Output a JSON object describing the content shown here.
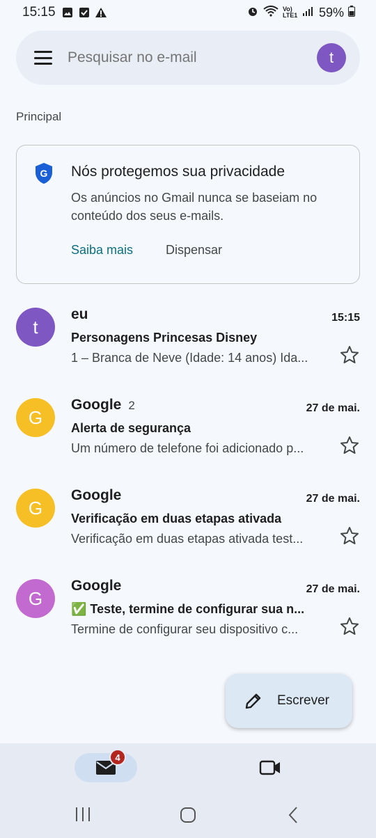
{
  "status_bar": {
    "time": "15:15",
    "network": "Vo) LTE1",
    "battery": "59%"
  },
  "search": {
    "placeholder": "Pesquisar no e-mail",
    "avatar_letter": "t"
  },
  "section_label": "Principal",
  "privacy_card": {
    "title": "Nós protegemos sua privacidade",
    "description": "Os anúncios no Gmail nunca se baseiam no conteúdo dos seus e-mails.",
    "learn_more": "Saiba mais",
    "dismiss": "Dispensar"
  },
  "emails": [
    {
      "avatar_letter": "t",
      "avatar_color": "#7e57c2",
      "sender": "eu",
      "count": "",
      "date": "15:15",
      "subject": "Personagens Princesas Disney",
      "snippet": "1 – Branca de Neve (Idade: 14 anos) Ida..."
    },
    {
      "avatar_letter": "G",
      "avatar_color": "#f6bf26",
      "sender": "Google",
      "count": "2",
      "date": "27 de mai.",
      "subject": "Alerta de segurança",
      "snippet": "Um número de telefone foi adicionado p..."
    },
    {
      "avatar_letter": "G",
      "avatar_color": "#f6bf26",
      "sender": "Google",
      "count": "",
      "date": "27 de mai.",
      "subject": "Verificação em duas etapas ativada",
      "snippet": "Verificação em duas etapas ativada test..."
    },
    {
      "avatar_letter": "G",
      "avatar_color": "#c26ad0",
      "sender": "Google",
      "count": "",
      "date": "27 de mai.",
      "subject": "✅ Teste, termine de configurar sua n...",
      "snippet": "Termine de configurar seu dispositivo c..."
    }
  ],
  "compose": {
    "label": "Escrever"
  },
  "bottom_nav": {
    "mail_badge": "4"
  },
  "colors": {
    "background": "#f5f8fd",
    "accent_link": "#0e6f7f",
    "badge": "#b3261e"
  }
}
